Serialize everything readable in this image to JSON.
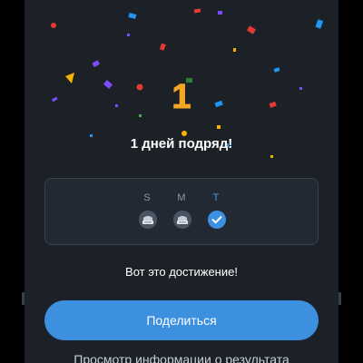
{
  "streak": {
    "count": "1",
    "title": "1 дней подряд!",
    "message": "Вот это достижение!"
  },
  "week": {
    "days": [
      {
        "letter": "S",
        "state": "frozen",
        "icon": "streak-freeze-icon"
      },
      {
        "letter": "M",
        "state": "frozen",
        "icon": "streak-freeze-icon"
      },
      {
        "letter": "T",
        "state": "done",
        "icon": "check-circle-icon"
      }
    ]
  },
  "actions": {
    "share_label": "Поделиться",
    "results_label": "Просмотр информации о результата"
  },
  "colors": {
    "background": "#1c2128",
    "accent": "#3d8fe0",
    "streak_number": "#f5a623"
  }
}
